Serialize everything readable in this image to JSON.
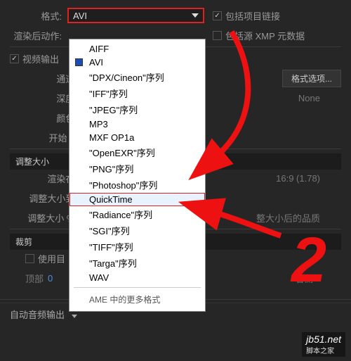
{
  "format": {
    "label": "格式:",
    "selected": "AVI",
    "include_link_label": "包括项目链接",
    "include_src_label": "包括源 XMP 元数据"
  },
  "post_render_label": "渲染后动作:",
  "video_output_label": "视频输出",
  "channel_label": "通道:",
  "depth_label": "深度:",
  "color_label": "颜色:",
  "start_label": "开始 #:",
  "format_options_btn": "格式选项...",
  "depth_val": "None",
  "resize": {
    "head": "调整大小",
    "at_label": "渲染在:",
    "aspect_right": "16:9 (1.78)",
    "resize_to_label": "调整大小到:",
    "resize_pct_label": "调整大小 %:",
    "after_quality": "整大小后的品质"
  },
  "crop": {
    "head": "裁剪",
    "use_target_label": "使用目",
    "top_label": "顶部",
    "top_val": "0",
    "right_label": "右侧",
    "right_val": ""
  },
  "audio": {
    "label": "自动音频输出"
  },
  "dd_items": [
    "AIFF",
    "AVI",
    "\"DPX/Cineon\"序列",
    "\"IFF\"序列",
    "\"JPEG\"序列",
    "MP3",
    "MXF OP1a",
    "\"OpenEXR\"序列",
    "\"PNG\"序列",
    "\"Photoshop\"序列",
    "QuickTime",
    "\"Radiance\"序列",
    "\"SGI\"序列",
    "\"TIFF\"序列",
    "\"Targa\"序列",
    "WAV"
  ],
  "dd_footer": "AME 中的更多格式",
  "watermark": {
    "site": "jb51.net",
    "sub": "脚本之家"
  },
  "annot": {
    "two": "2"
  }
}
